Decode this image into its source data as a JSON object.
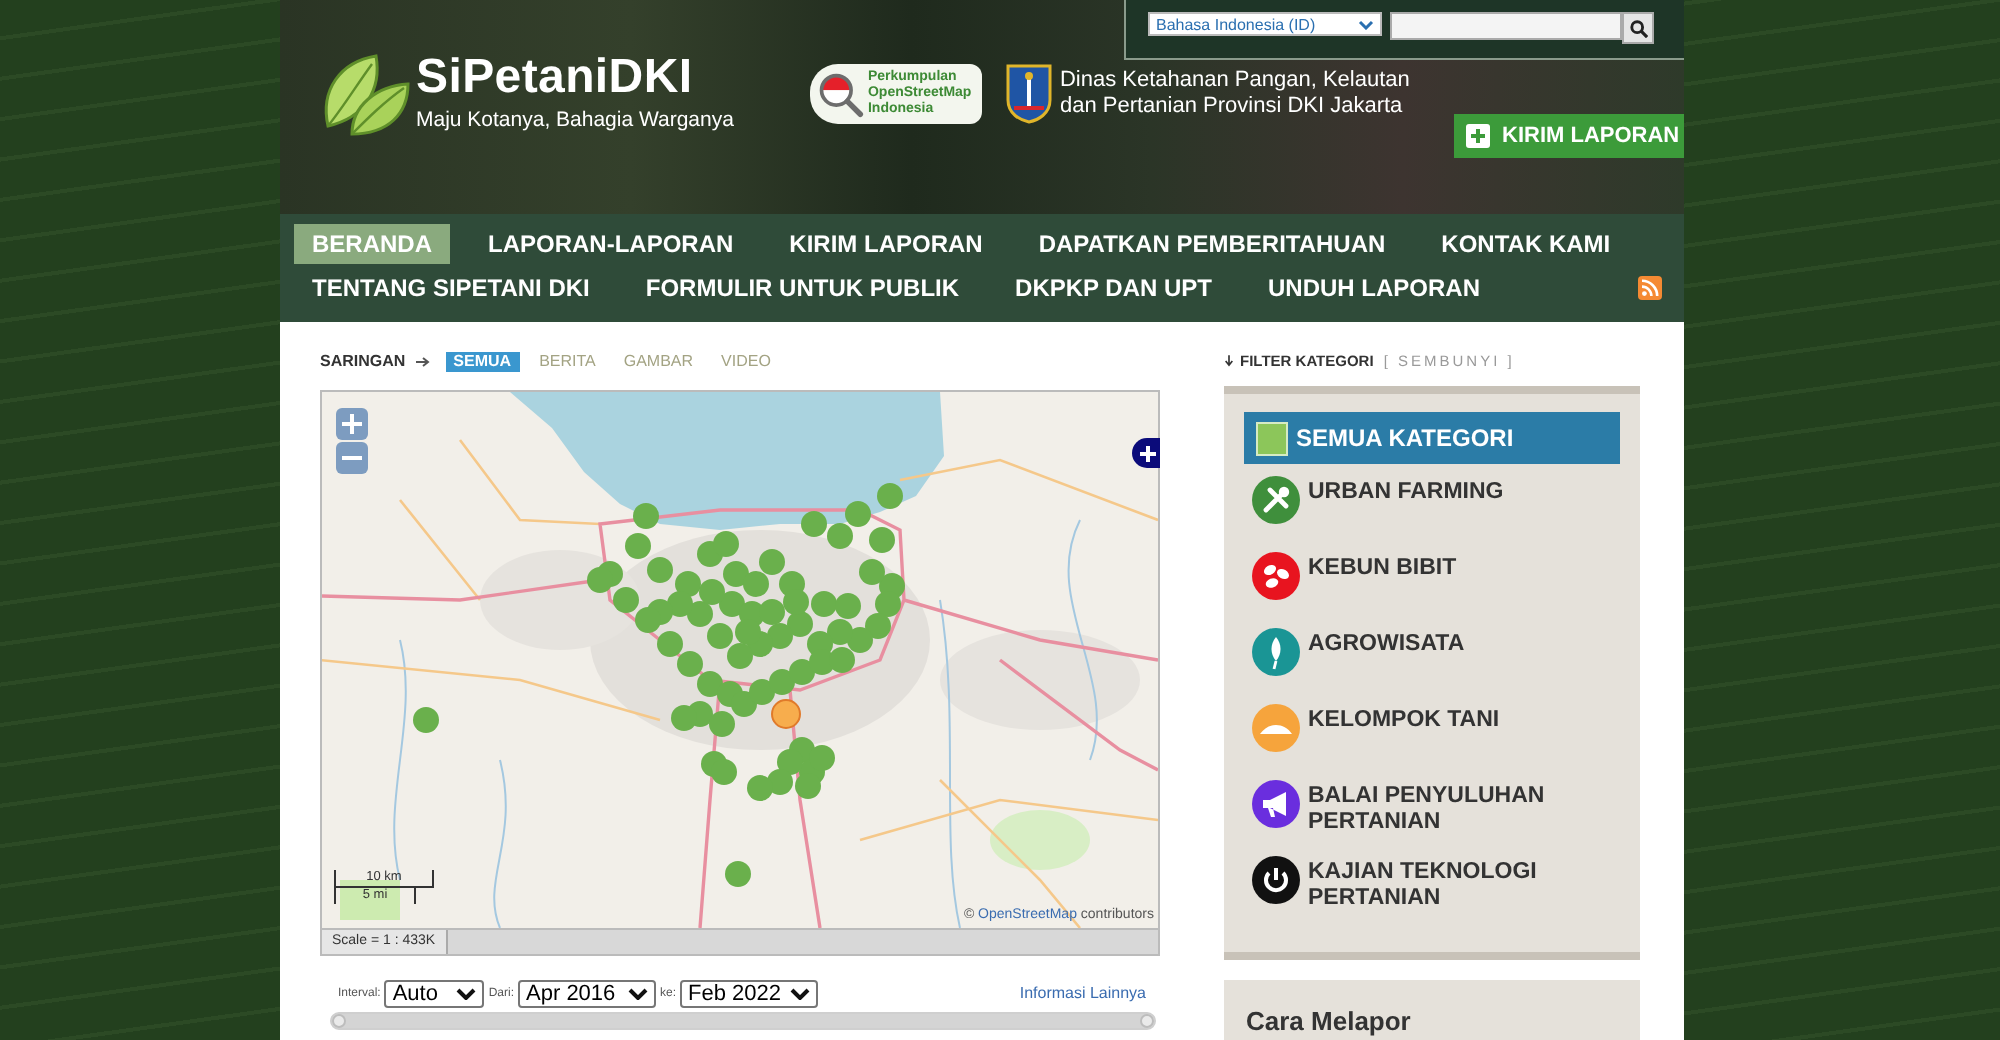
{
  "header": {
    "site_title": "SiPetaniDKI",
    "tagline": "Maju Kotanya, Bahagia Warganya",
    "partner": "Perkumpulan OpenStreetMap Indonesia",
    "agency_lines": [
      "Dinas Ketahanan Pangan, Kelautan",
      "dan Pertanian Provinsi DKI Jakarta"
    ],
    "language": "Bahasa Indonesia (ID)",
    "report_button": "KIRIM LAPORAN"
  },
  "nav": [
    {
      "label": "BERANDA",
      "selected": true
    },
    {
      "label": "LAPORAN-LAPORAN",
      "selected": false
    },
    {
      "label": "KIRIM LAPORAN",
      "selected": false
    },
    {
      "label": "DAPATKAN PEMBERITAHUAN",
      "selected": false
    },
    {
      "label": "KONTAK KAMI",
      "selected": false
    },
    {
      "label": "TENTANG SIPETANI DKI",
      "selected": false
    },
    {
      "label": "FORMULIR UNTUK PUBLIK",
      "selected": false
    },
    {
      "label": "DKPKP DAN UPT",
      "selected": false
    },
    {
      "label": "UNDUH LAPORAN",
      "selected": false
    }
  ],
  "filter_bar": {
    "label": "SARINGAN",
    "items": [
      {
        "label": "SEMUA",
        "selected": true
      },
      {
        "label": "BERITA",
        "selected": false
      },
      {
        "label": "GAMBAR",
        "selected": false
      },
      {
        "label": "VIDEO",
        "selected": false
      }
    ]
  },
  "map": {
    "scale_bar": {
      "metric": "10 km",
      "imperial": "5 mi"
    },
    "attribution": {
      "prefix": "©",
      "link": "OpenStreetMap",
      "suffix": "contributors"
    },
    "scale": "Scale = 1 : 433K"
  },
  "timeline": {
    "interval_label": "Interval:",
    "interval": "Auto",
    "from_label": "Dari:",
    "from": "Apr 2016",
    "to_label": "ke:",
    "to": "Feb 2022",
    "more_link": "Informasi Lainnya",
    "slider": {
      "level": 1
    }
  },
  "category_filter": {
    "title": "FILTER KATEGORI",
    "toggle": "[ SEMBUNYI ]",
    "items": [
      {
        "kind": "all",
        "label": "SEMUA KATEGORI",
        "selected": true,
        "color": "#8cc65a"
      },
      {
        "kind": "category",
        "label": "URBAN FARMING",
        "selected": false,
        "color": "#3f8f3c"
      },
      {
        "kind": "category",
        "label": "KEBUN BIBIT",
        "selected": false,
        "color": "#e8141f"
      },
      {
        "kind": "category",
        "label": "AGROWISATA",
        "selected": false,
        "color": "#1a9595"
      },
      {
        "kind": "category",
        "label": "KELOMPOK TANI",
        "selected": false,
        "color": "#f6a43c"
      },
      {
        "kind": "category",
        "label": "BALAI PENYULUHAN PERTANIAN",
        "selected": false,
        "color": "#6a2ede"
      },
      {
        "kind": "category",
        "label": "KAJIAN TEKNOLOGI PERTANIAN",
        "selected": false,
        "color": "#111111"
      }
    ]
  },
  "sidebar_card": {
    "title": "Cara Melapor"
  }
}
